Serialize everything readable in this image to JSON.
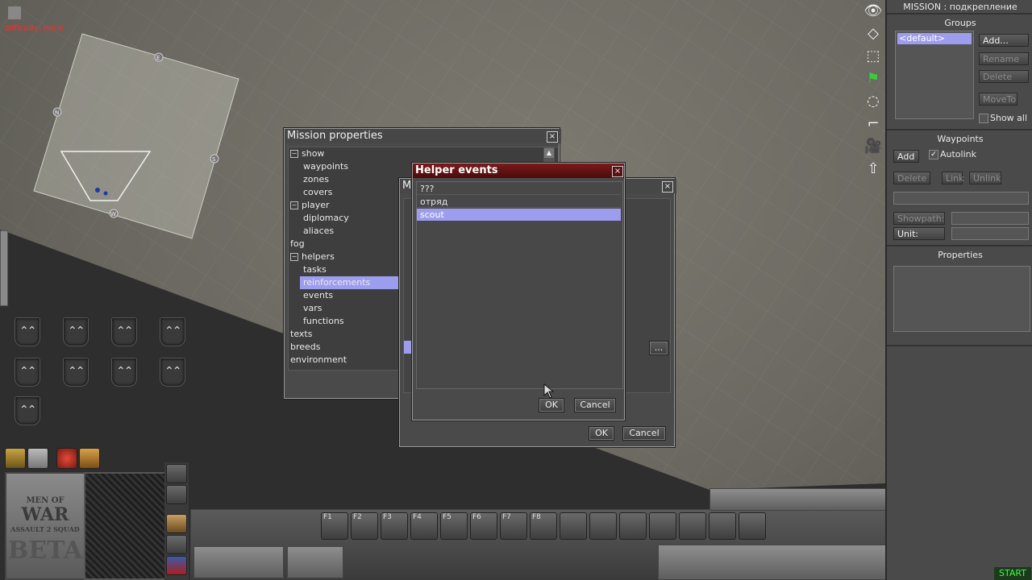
{
  "viewport": {
    "difficulty_label": "difficulty: none",
    "zone_markers": [
      "E",
      "N",
      "S",
      "W"
    ],
    "fkeys": [
      "F1",
      "F2",
      "F3",
      "F4",
      "F5",
      "F6",
      "F7",
      "F8"
    ],
    "logo": {
      "line1": "MEN OF",
      "line2": "WAR",
      "line3": "ASSAULT 2 SQUAD",
      "line4": "BETA"
    }
  },
  "mission_properties": {
    "title": "Mission properties",
    "close": "×",
    "tree": [
      {
        "label": "show",
        "expander": "−",
        "level": 0
      },
      {
        "label": "waypoints",
        "level": 1
      },
      {
        "label": "zones",
        "level": 1
      },
      {
        "label": "covers",
        "level": 1
      },
      {
        "label": "player",
        "expander": "−",
        "level": 0
      },
      {
        "label": "diplomacy",
        "level": 1
      },
      {
        "label": "aliaces",
        "level": 1
      },
      {
        "label": "fog",
        "level": 0
      },
      {
        "label": "helpers",
        "expander": "−",
        "level": 0
      },
      {
        "label": "tasks",
        "level": 1
      },
      {
        "label": "reinforcements",
        "level": 1,
        "selected": true
      },
      {
        "label": "events",
        "level": 1
      },
      {
        "label": "vars",
        "level": 1
      },
      {
        "label": "functions",
        "level": 1
      },
      {
        "label": "texts",
        "level": 0
      },
      {
        "label": "breeds",
        "level": 0
      },
      {
        "label": "environment",
        "level": 0
      }
    ]
  },
  "mid_dialog": {
    "title": "Mi",
    "close": "×",
    "ellipsis": "...",
    "ok": "OK",
    "cancel": "Cancel"
  },
  "helper_events": {
    "title": "Helper events",
    "close": "×",
    "items": [
      {
        "label": "???"
      },
      {
        "label": "отряд"
      },
      {
        "label": "scout",
        "selected": true
      }
    ],
    "ok": "OK",
    "cancel": "Cancel"
  },
  "right_panel": {
    "title": "MISSION : подкрепление",
    "groups": {
      "heading": "Groups",
      "items": [
        "<default>"
      ],
      "add": "Add...",
      "rename": "Rename",
      "delete": "Delete",
      "moveto": "MoveTo",
      "show_all": "Show all"
    },
    "waypoints": {
      "heading": "Waypoints",
      "add": "Add",
      "autolink": "Autolink",
      "delete": "Delete",
      "link": "Link",
      "unlink": "Unlink",
      "showpath": "Showpath:",
      "unit": "Unit:"
    },
    "properties": {
      "heading": "Properties"
    },
    "start": "START"
  },
  "toolstrip": [
    "eye-icon",
    "diamond-icon",
    "dashed-square-icon",
    "flag-icon",
    "dashed-circle-icon",
    "step-icon",
    "camera-icon",
    "arrow-up-icon"
  ]
}
